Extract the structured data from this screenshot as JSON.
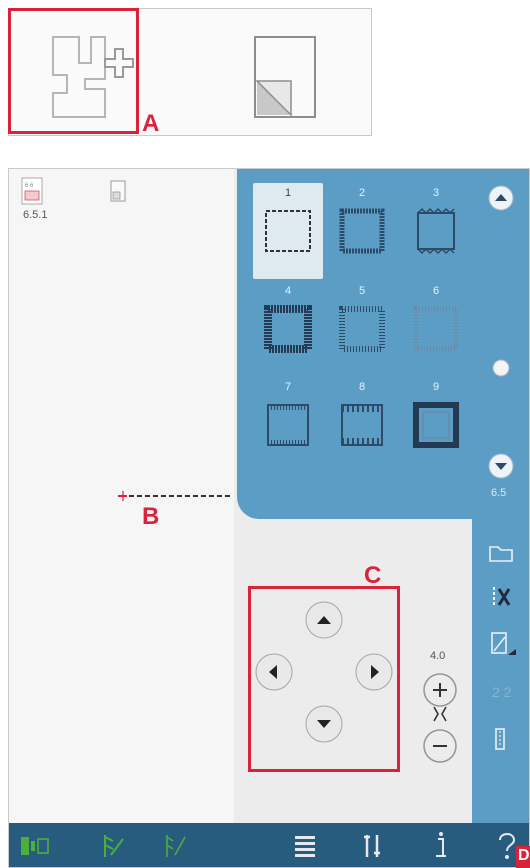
{
  "callouts": {
    "a": "A",
    "b": "B",
    "c": "C",
    "d": "D"
  },
  "side_panel": {
    "version": "6.5.1"
  },
  "stitch_picker": {
    "cells": [
      {
        "number": "1",
        "selected": true
      },
      {
        "number": "2",
        "selected": false
      },
      {
        "number": "3",
        "selected": false
      },
      {
        "number": "4",
        "selected": false
      },
      {
        "number": "5",
        "selected": false
      },
      {
        "number": "6",
        "selected": false
      },
      {
        "number": "7",
        "selected": false
      },
      {
        "number": "8",
        "selected": false
      },
      {
        "number": "9",
        "selected": false
      }
    ],
    "page_label": "6.5"
  },
  "position_control": {
    "value": "4.0"
  },
  "colors": {
    "panel_blue": "#5c9dc6",
    "bar_blue": "#275c7f",
    "callout_red": "#d8233b",
    "icon_green": "#4cae3c"
  }
}
